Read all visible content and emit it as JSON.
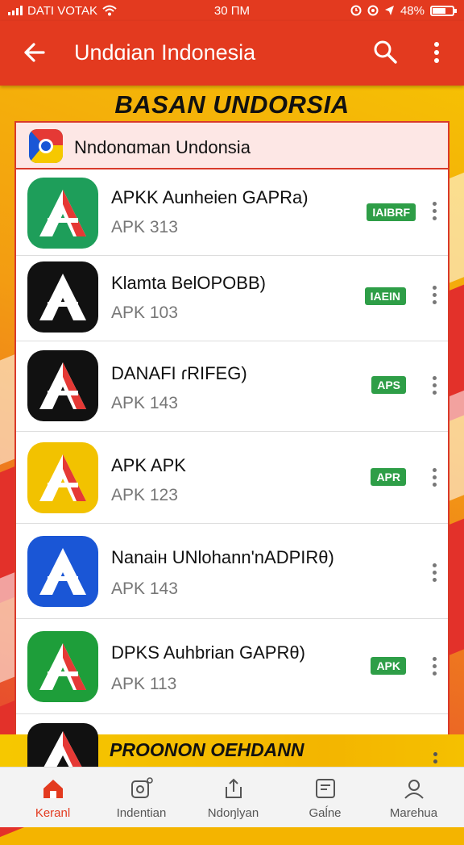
{
  "status_bar": {
    "carrier": "DATI VOTAK",
    "time": "30 ПМ",
    "battery": "48%"
  },
  "app_bar": {
    "title": "Undɑian Indonesia"
  },
  "banner": {
    "title": "BASAN UNDORSIA"
  },
  "search": {
    "text": "Nndonɑman Undonsia"
  },
  "apps": [
    {
      "name": "APKK Aunheien GAPRa)",
      "sub": "APK 313",
      "badge": "IAIBRF",
      "icon_bg": "#1e9e5a",
      "icon_color": "green"
    },
    {
      "name": "Klamta BelOPOBB)",
      "sub": "APK 103",
      "badge": "IAEIN",
      "icon_bg": "#111111",
      "icon_color": "black"
    },
    {
      "name": "DANAFI ɾRIFEG)",
      "sub": "APK 143",
      "badge": "APS",
      "icon_bg": "#111111",
      "icon_color": "black"
    },
    {
      "name": "APK APK",
      "sub": "APK 123",
      "badge": "APR",
      "icon_bg": "#f2c200",
      "icon_color": "yellow"
    },
    {
      "name": "Nanaiн UNlohann'nADPIRθ)",
      "sub": "APK 143",
      "badge": "",
      "icon_bg": "#1a56d6",
      "icon_color": "blue"
    },
    {
      "name": "DPKS Auhbrian GAPRθ)",
      "sub": "APK 113",
      "badge": "APK",
      "icon_bg": "#1e9e3a",
      "icon_color": "green"
    }
  ],
  "promo": {
    "text": "PROONON OEHDANN"
  },
  "bottom_nav": [
    {
      "label": "Keranl",
      "icon": "home-icon",
      "active": true
    },
    {
      "label": "Indentian",
      "icon": "camera-icon",
      "active": false
    },
    {
      "label": "Ndoŋlyan",
      "icon": "share-icon",
      "active": false
    },
    {
      "label": "Gaĺne",
      "icon": "card-icon",
      "active": false
    },
    {
      "label": "Marehua",
      "icon": "user-icon",
      "active": false
    }
  ],
  "colors": {
    "primary_red": "#e33a1f",
    "badge_green": "#2e9e47",
    "accent_yellow": "#f6c800"
  }
}
